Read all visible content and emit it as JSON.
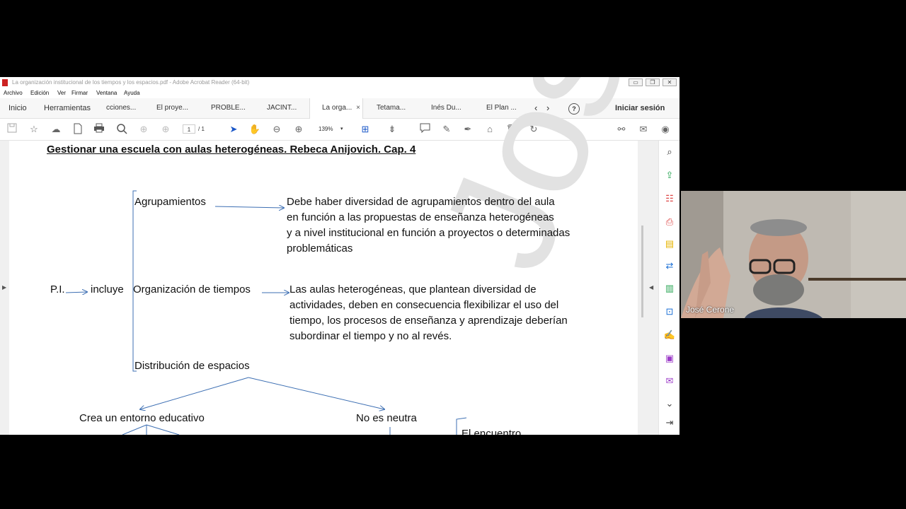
{
  "window": {
    "title": "La organización institucional de los tiempos y los espacios.pdf - Adobe Acrobat Reader (64-bit)",
    "buttons": [
      "▭",
      "❐",
      "✕"
    ]
  },
  "menu": [
    "Archivo",
    "Edición",
    "Ver",
    "Firmar",
    "Ventana",
    "Ayuda"
  ],
  "tabs": {
    "home": "Inicio",
    "tools": "Herramientas",
    "docs": [
      "cciones...",
      "El proye...",
      "PROBLE...",
      "JACINT...",
      "La orga...",
      "Tetama...",
      "Inés Du...",
      "El Plan ..."
    ],
    "active_index": 4,
    "close_glyph": "×",
    "sign_in": "Iniciar sesión"
  },
  "toolbar": {
    "page_current": "1",
    "page_total": "/ 1",
    "zoom": "139%"
  },
  "document": {
    "heading": "Gestionar una escuela con aulas heterogéneas. Rebeca Anijovich. Cap. 4",
    "pi": "P.I.",
    "incluye": "incluye",
    "item1": "Agrupamientos",
    "item1_desc": [
      "Debe haber diversidad de agrupamientos dentro del aula",
      "en función a las propuestas de enseñanza heterogéneas",
      "y a nivel institucional en función a proyectos o determinadas",
      "problemáticas"
    ],
    "item2": "Organización de tiempos",
    "item2_desc": [
      "Las aulas heterogéneas, que plantean diversidad de",
      "actividades, deben en consecuencia flexibilizar el uso del",
      "tiempo, los procesos de enseñanza y aprendizaje deberían",
      "subordinar el tiempo y no al revés."
    ],
    "item3": "Distribución de espacios",
    "branch_left": "Crea un entorno educativo",
    "branch_right": "No es neutra",
    "partial": "El encuentro",
    "watermark": "José Cerone"
  },
  "video": {
    "participant": "José Cerone"
  },
  "colors": {
    "arrow": "#3d6fb3",
    "tab_bg": "#f7f7f7",
    "watermark": "#e2e2e2"
  }
}
